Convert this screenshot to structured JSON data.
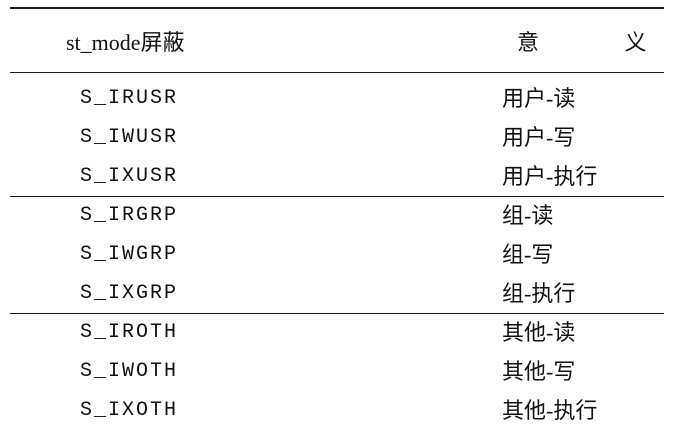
{
  "table": {
    "header": {
      "mask": "st_mode屏蔽",
      "meaning": "意 义"
    },
    "groups": [
      {
        "rows": [
          {
            "mask": "S_IRUSR",
            "meaning": "用户-读"
          },
          {
            "mask": "S_IWUSR",
            "meaning": "用户-写"
          },
          {
            "mask": "S_IXUSR",
            "meaning": "用户-执行"
          }
        ]
      },
      {
        "rows": [
          {
            "mask": "S_IRGRP",
            "meaning": "组-读"
          },
          {
            "mask": "S_IWGRP",
            "meaning": "组-写"
          },
          {
            "mask": "S_IXGRP",
            "meaning": "组-执行"
          }
        ]
      },
      {
        "rows": [
          {
            "mask": "S_IROTH",
            "meaning": "其他-读"
          },
          {
            "mask": "S_IWOTH",
            "meaning": "其他-写"
          },
          {
            "mask": "S_IXOTH",
            "meaning": "其他-执行"
          }
        ]
      }
    ]
  }
}
